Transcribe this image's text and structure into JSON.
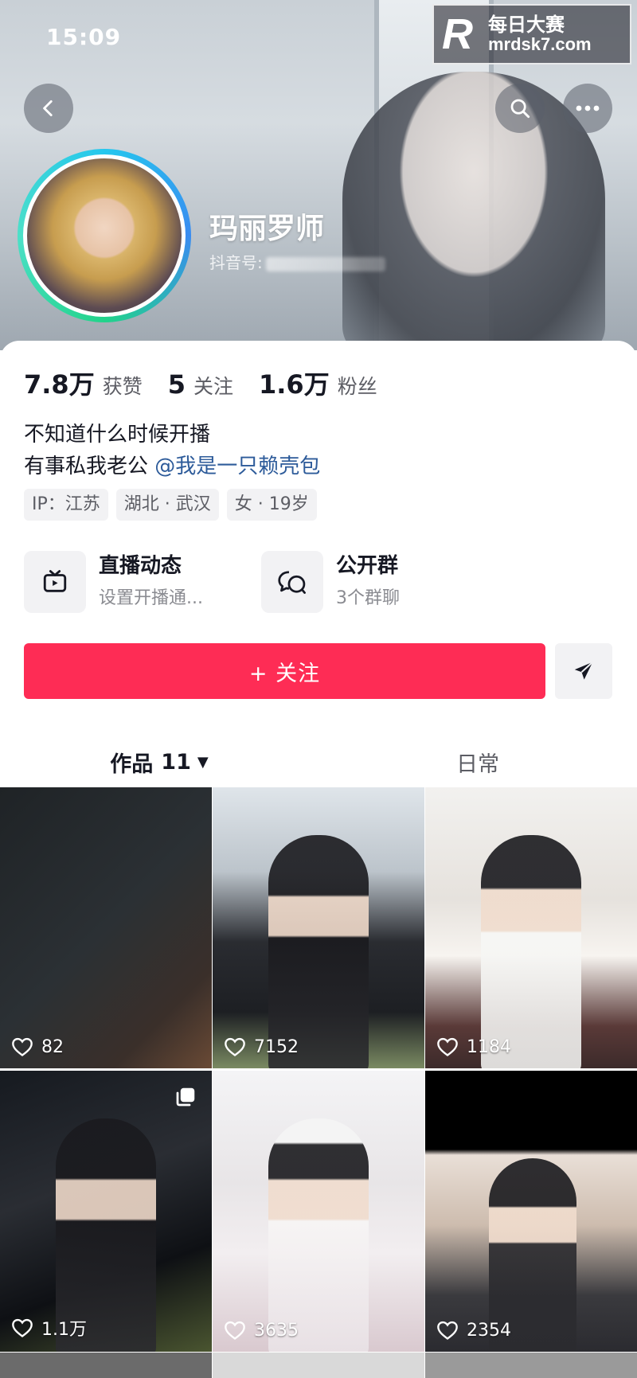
{
  "status_bar": {
    "time": "15:09"
  },
  "watermark": {
    "logo": "R",
    "line1": "每日大赛",
    "line2": "mrdsk7.com"
  },
  "header": {
    "back_icon": "chevron-left-icon",
    "search_icon": "search-icon",
    "more_icon": "more-dots-icon"
  },
  "profile": {
    "name": "玛丽罗师",
    "id_label": "抖音号:"
  },
  "stats": [
    {
      "value": "7.8万",
      "label": "获赞"
    },
    {
      "value": "5",
      "label": "关注"
    },
    {
      "value": "1.6万",
      "label": "粉丝"
    }
  ],
  "bio": {
    "line1": "不知道什么时候开播",
    "line2_prefix": "有事私我老公 ",
    "mention": "@我是一只赖壳包"
  },
  "tags": [
    "IP：江苏",
    "湖北 · 武汉",
    "女 · 19岁"
  ],
  "features": {
    "live": {
      "title": "直播动态",
      "subtitle": "设置开播通...",
      "icon": "tv-icon"
    },
    "group": {
      "title": "公开群",
      "subtitle": "3个群聊",
      "icon": "chat-bubbles-icon"
    }
  },
  "actions": {
    "follow_label": "+ 关注",
    "share_icon": "send-icon"
  },
  "tabs": {
    "works": {
      "label": "作品",
      "count": "11",
      "caret": "▼"
    },
    "daily": {
      "label": "日常"
    }
  },
  "videos": [
    {
      "likes": "82"
    },
    {
      "likes": "7152"
    },
    {
      "likes": "1184"
    },
    {
      "likes": "1.1万",
      "multi_image": true
    },
    {
      "likes": "3635"
    },
    {
      "likes": "2354"
    }
  ],
  "colors": {
    "accent": "#fe2c55",
    "mention": "#2d5b9a",
    "text_primary": "#161823",
    "text_secondary": "#5c5d64"
  }
}
